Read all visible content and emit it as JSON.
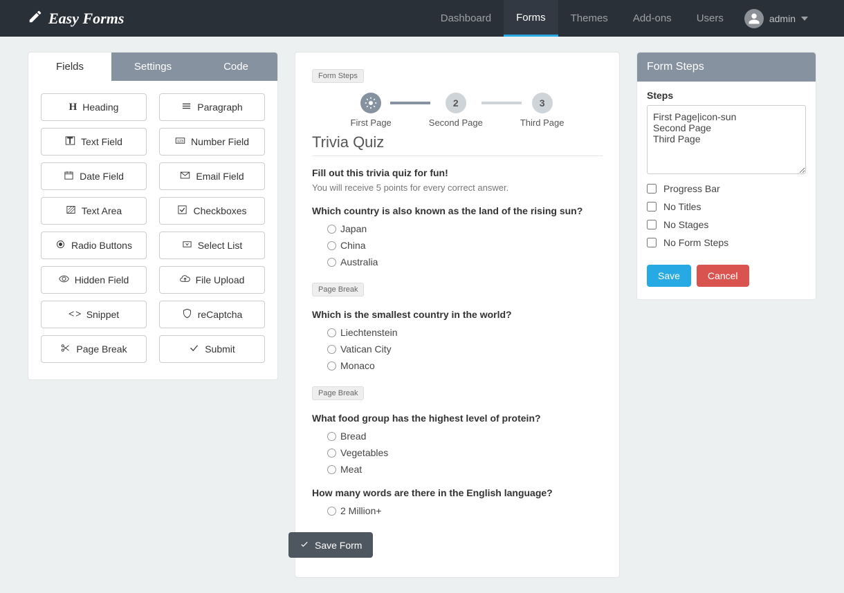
{
  "brand": "Easy Forms",
  "nav": {
    "items": [
      {
        "label": "Dashboard",
        "active": false
      },
      {
        "label": "Forms",
        "active": true
      },
      {
        "label": "Themes",
        "active": false
      },
      {
        "label": "Add-ons",
        "active": false
      },
      {
        "label": "Users",
        "active": false
      }
    ],
    "user": "admin"
  },
  "toolbox": {
    "tabs": [
      "Fields",
      "Settings",
      "Code"
    ],
    "fields": [
      {
        "label": "Heading",
        "icon": "heading-icon"
      },
      {
        "label": "Paragraph",
        "icon": "paragraph-icon"
      },
      {
        "label": "Text Field",
        "icon": "text-field-icon"
      },
      {
        "label": "Number Field",
        "icon": "number-field-icon"
      },
      {
        "label": "Date Field",
        "icon": "date-field-icon"
      },
      {
        "label": "Email Field",
        "icon": "email-field-icon"
      },
      {
        "label": "Text Area",
        "icon": "text-area-icon"
      },
      {
        "label": "Checkboxes",
        "icon": "checkboxes-icon"
      },
      {
        "label": "Radio Buttons",
        "icon": "radio-icon"
      },
      {
        "label": "Select List",
        "icon": "select-icon"
      },
      {
        "label": "Hidden Field",
        "icon": "hidden-icon"
      },
      {
        "label": "File Upload",
        "icon": "upload-icon"
      },
      {
        "label": "Snippet",
        "icon": "code-icon"
      },
      {
        "label": "reCaptcha",
        "icon": "shield-icon"
      },
      {
        "label": "Page Break",
        "icon": "scissors-icon"
      },
      {
        "label": "Submit",
        "icon": "check-icon"
      }
    ]
  },
  "canvas": {
    "form_steps_badge": "Form Steps",
    "page_break_badge": "Page Break",
    "stepper": [
      {
        "label": "First Page",
        "icon": "sun",
        "current": true
      },
      {
        "label": "Second Page",
        "num": "2",
        "current": false
      },
      {
        "label": "Third Page",
        "num": "3",
        "current": false
      }
    ],
    "title": "Trivia Quiz",
    "heading": "Fill out this trivia quiz for fun!",
    "desc": "You will receive 5 points for every correct answer.",
    "questions": [
      {
        "text": "Which country is also known as the land of the rising sun?",
        "options": [
          "Japan",
          "China",
          "Australia"
        ]
      },
      {
        "text": "Which is the smallest country in the world?",
        "options": [
          "Liechtenstein",
          "Vatican City",
          "Monaco"
        ]
      },
      {
        "text": "What food group has the highest level of protein?",
        "options": [
          "Bread",
          "Vegetables",
          "Meat"
        ]
      },
      {
        "text": "How many words are there in the English language?",
        "options": [
          "2 Million+"
        ]
      }
    ],
    "save_form": "Save Form"
  },
  "inspector": {
    "title": "Form Steps",
    "steps_label": "Steps",
    "steps_value": "First Page|icon-sun\nSecond Page\nThird Page",
    "checks": [
      {
        "label": "Progress Bar",
        "checked": false
      },
      {
        "label": "No Titles",
        "checked": false
      },
      {
        "label": "No Stages",
        "checked": false
      },
      {
        "label": "No Form Steps",
        "checked": false
      }
    ],
    "save": "Save",
    "cancel": "Cancel"
  }
}
